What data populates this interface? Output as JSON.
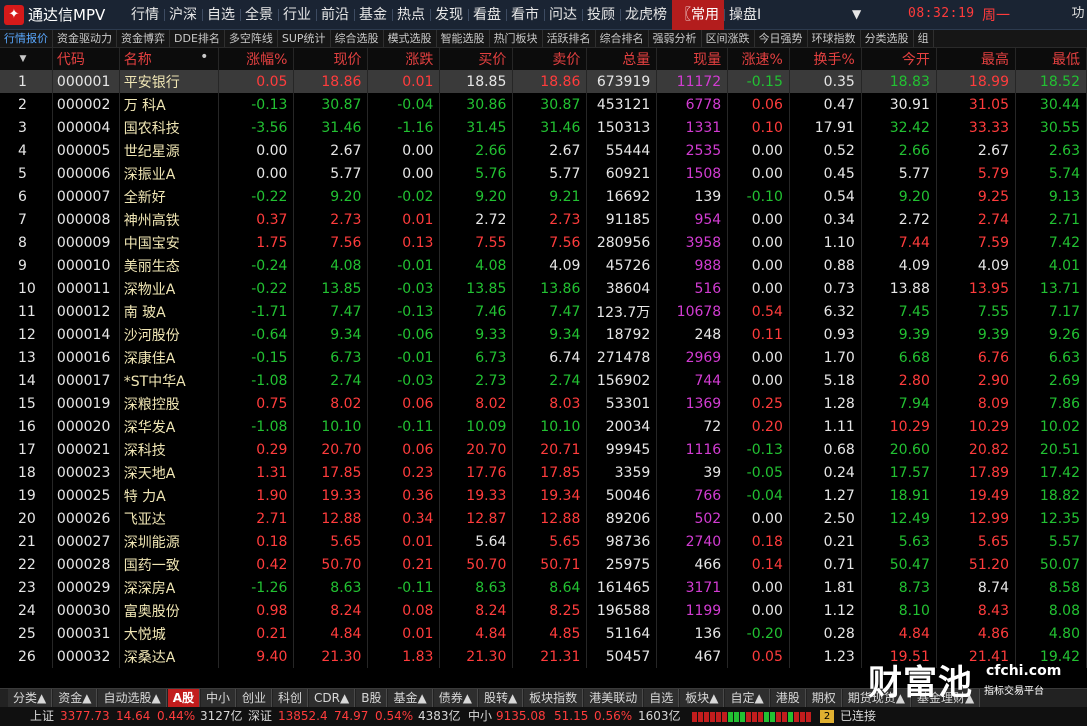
{
  "app": {
    "title": "通达信MPV",
    "logo": "tdx-logo-icon"
  },
  "main_menu": [
    "行情",
    "沪深",
    "自选",
    "全景",
    "行业",
    "前沿",
    "基金",
    "热点",
    "发现",
    "看盘",
    "看市",
    "问达",
    "投顾",
    "龙虎榜",
    "〖常用",
    "操盘Ⅰ"
  ],
  "main_menu_active": 14,
  "clock": {
    "time": "08:32:19",
    "weekday": "周一"
  },
  "window_controls": [
    "功"
  ],
  "toolbar2": [
    "行情报价",
    "资金驱动力",
    "资金博弈",
    "DDE排名",
    "多空阵线",
    "SUP统计",
    "综合选股",
    "模式选股",
    "智能选股",
    "热门板块",
    "活跃排名",
    "综合排名",
    "强弱分析",
    "区间涨跌",
    "今日强势",
    "环球指数",
    "分类选股",
    "组"
  ],
  "toolbar2_active": 0,
  "table": {
    "columns": [
      "",
      "代码",
      "名称",
      "涨幅%",
      "现价",
      "涨跌",
      "买价",
      "卖价",
      "总量",
      "现量",
      "涨速%",
      "换手%",
      "今开",
      "最高",
      "最低"
    ],
    "name_sort_marker": "•",
    "rows": [
      [
        "1",
        "000001",
        "平安银行",
        "0.05",
        "18.86",
        "0.01",
        "18.85",
        "18.86",
        "673919",
        "11172",
        "-0.15",
        "0.35",
        "18.83",
        "18.99",
        "18.52"
      ],
      [
        "2",
        "000002",
        "万 科A",
        "-0.13",
        "30.87",
        "-0.04",
        "30.86",
        "30.87",
        "453121",
        "6778",
        "0.06",
        "0.47",
        "30.91",
        "31.05",
        "30.44"
      ],
      [
        "3",
        "000004",
        "国农科技",
        "-3.56",
        "31.46",
        "-1.16",
        "31.45",
        "31.46",
        "150313",
        "1331",
        "0.10",
        "17.91",
        "32.42",
        "33.33",
        "30.55"
      ],
      [
        "4",
        "000005",
        "世纪星源",
        "0.00",
        "2.67",
        "0.00",
        "2.66",
        "2.67",
        "55444",
        "2535",
        "0.00",
        "0.52",
        "2.66",
        "2.67",
        "2.63"
      ],
      [
        "5",
        "000006",
        "深振业A",
        "0.00",
        "5.77",
        "0.00",
        "5.76",
        "5.77",
        "60921",
        "1508",
        "0.00",
        "0.45",
        "5.77",
        "5.79",
        "5.74"
      ],
      [
        "6",
        "000007",
        "全新好",
        "-0.22",
        "9.20",
        "-0.02",
        "9.20",
        "9.21",
        "16692",
        "139",
        "-0.10",
        "0.54",
        "9.20",
        "9.25",
        "9.13"
      ],
      [
        "7",
        "000008",
        "神州高铁",
        "0.37",
        "2.73",
        "0.01",
        "2.72",
        "2.73",
        "91185",
        "954",
        "0.00",
        "0.34",
        "2.72",
        "2.74",
        "2.71"
      ],
      [
        "8",
        "000009",
        "中国宝安",
        "1.75",
        "7.56",
        "0.13",
        "7.55",
        "7.56",
        "280956",
        "3958",
        "0.00",
        "1.10",
        "7.44",
        "7.59",
        "7.42"
      ],
      [
        "9",
        "000010",
        "美丽生态",
        "-0.24",
        "4.08",
        "-0.01",
        "4.08",
        "4.09",
        "45726",
        "988",
        "0.00",
        "0.88",
        "4.09",
        "4.09",
        "4.01"
      ],
      [
        "10",
        "000011",
        "深物业A",
        "-0.22",
        "13.85",
        "-0.03",
        "13.85",
        "13.86",
        "38604",
        "516",
        "0.00",
        "0.73",
        "13.88",
        "13.95",
        "13.71"
      ],
      [
        "11",
        "000012",
        "南 玻A",
        "-1.71",
        "7.47",
        "-0.13",
        "7.46",
        "7.47",
        "123.7万",
        "10678",
        "0.54",
        "6.32",
        "7.45",
        "7.55",
        "7.17"
      ],
      [
        "12",
        "000014",
        "沙河股份",
        "-0.64",
        "9.34",
        "-0.06",
        "9.33",
        "9.34",
        "18792",
        "248",
        "0.11",
        "0.93",
        "9.39",
        "9.39",
        "9.26"
      ],
      [
        "13",
        "000016",
        "深康佳A",
        "-0.15",
        "6.73",
        "-0.01",
        "6.73",
        "6.74",
        "271478",
        "2969",
        "0.00",
        "1.70",
        "6.68",
        "6.76",
        "6.63"
      ],
      [
        "14",
        "000017",
        "*ST中华A",
        "-1.08",
        "2.74",
        "-0.03",
        "2.73",
        "2.74",
        "156902",
        "744",
        "0.00",
        "5.18",
        "2.80",
        "2.90",
        "2.69"
      ],
      [
        "15",
        "000019",
        "深粮控股",
        "0.75",
        "8.02",
        "0.06",
        "8.02",
        "8.03",
        "53301",
        "1369",
        "0.25",
        "1.28",
        "7.94",
        "8.09",
        "7.86"
      ],
      [
        "16",
        "000020",
        "深华发A",
        "-1.08",
        "10.10",
        "-0.11",
        "10.09",
        "10.10",
        "20034",
        "72",
        "0.20",
        "1.11",
        "10.29",
        "10.29",
        "10.02"
      ],
      [
        "17",
        "000021",
        "深科技",
        "0.29",
        "20.70",
        "0.06",
        "20.70",
        "20.71",
        "99945",
        "1116",
        "-0.13",
        "0.68",
        "20.60",
        "20.82",
        "20.51"
      ],
      [
        "18",
        "000023",
        "深天地A",
        "1.31",
        "17.85",
        "0.23",
        "17.76",
        "17.85",
        "3359",
        "39",
        "-0.05",
        "0.24",
        "17.57",
        "17.89",
        "17.42"
      ],
      [
        "19",
        "000025",
        "特 力A",
        "1.90",
        "19.33",
        "0.36",
        "19.33",
        "19.34",
        "50046",
        "766",
        "-0.04",
        "1.27",
        "18.91",
        "19.49",
        "18.82"
      ],
      [
        "20",
        "000026",
        "飞亚达",
        "2.71",
        "12.88",
        "0.34",
        "12.87",
        "12.88",
        "89206",
        "502",
        "0.00",
        "2.50",
        "12.49",
        "12.99",
        "12.35"
      ],
      [
        "21",
        "000027",
        "深圳能源",
        "0.18",
        "5.65",
        "0.01",
        "5.64",
        "5.65",
        "98736",
        "2740",
        "0.18",
        "0.21",
        "5.63",
        "5.65",
        "5.57"
      ],
      [
        "22",
        "000028",
        "国药一致",
        "0.42",
        "50.70",
        "0.21",
        "50.70",
        "50.71",
        "25975",
        "466",
        "0.14",
        "0.71",
        "50.47",
        "51.20",
        "50.07"
      ],
      [
        "23",
        "000029",
        "深深房A",
        "-1.26",
        "8.63",
        "-0.11",
        "8.63",
        "8.64",
        "161465",
        "3171",
        "0.00",
        "1.81",
        "8.73",
        "8.74",
        "8.58"
      ],
      [
        "24",
        "000030",
        "富奥股份",
        "0.98",
        "8.24",
        "0.08",
        "8.24",
        "8.25",
        "196588",
        "1199",
        "0.00",
        "1.12",
        "8.10",
        "8.43",
        "8.08"
      ],
      [
        "25",
        "000031",
        "大悦城",
        "0.21",
        "4.84",
        "0.01",
        "4.84",
        "4.85",
        "51164",
        "136",
        "-0.20",
        "0.28",
        "4.84",
        "4.86",
        "4.80"
      ],
      [
        "26",
        "000032",
        "深桑达A",
        "9.40",
        "21.30",
        "1.83",
        "21.30",
        "21.31",
        "50457",
        "467",
        "0.05",
        "1.23",
        "19.51",
        "21.41",
        "19.42"
      ]
    ]
  },
  "bottom_tabs": [
    "分类▲",
    "资金▲",
    "自动选股▲",
    "A股",
    "中小",
    "创业",
    "科创",
    "CDR▲",
    "B股",
    "基金▲",
    "债券▲",
    "股转▲",
    "板块指数",
    "港美联动",
    "自选",
    "板块▲",
    "自定▲",
    "港股",
    "期权",
    "期货现货▲",
    "基金理财▲"
  ],
  "bottom_tab_active": 3,
  "status": {
    "sh_label": "上证",
    "sh_index": "3377.73",
    "sh_change": "14.64",
    "sh_pct": "0.44%",
    "sh_amount": "3127亿",
    "sz_label": "深证",
    "sz_index": "13852.4",
    "sz_change": "74.97",
    "sz_pct": "0.54%",
    "sz_amount": "4383亿",
    "zx_label": "中小",
    "zx_index": "9135.08",
    "zx_change": "51.15",
    "zx_pct": "0.56%",
    "zx_amount": "1603亿",
    "conn_icon_text": "2",
    "conn_text": "已连接"
  },
  "watermark": {
    "cn": "财富池",
    "url": "cfchi.com",
    "sub": "指标交易平台"
  },
  "colors": {
    "up": "#ff3c3c",
    "down": "#22c132",
    "flat": "#e6e6e6",
    "header": "#e34040",
    "name": "#f0e6b4",
    "accent_tab": "#c21d1d",
    "current_volume": "#d23cd2"
  }
}
